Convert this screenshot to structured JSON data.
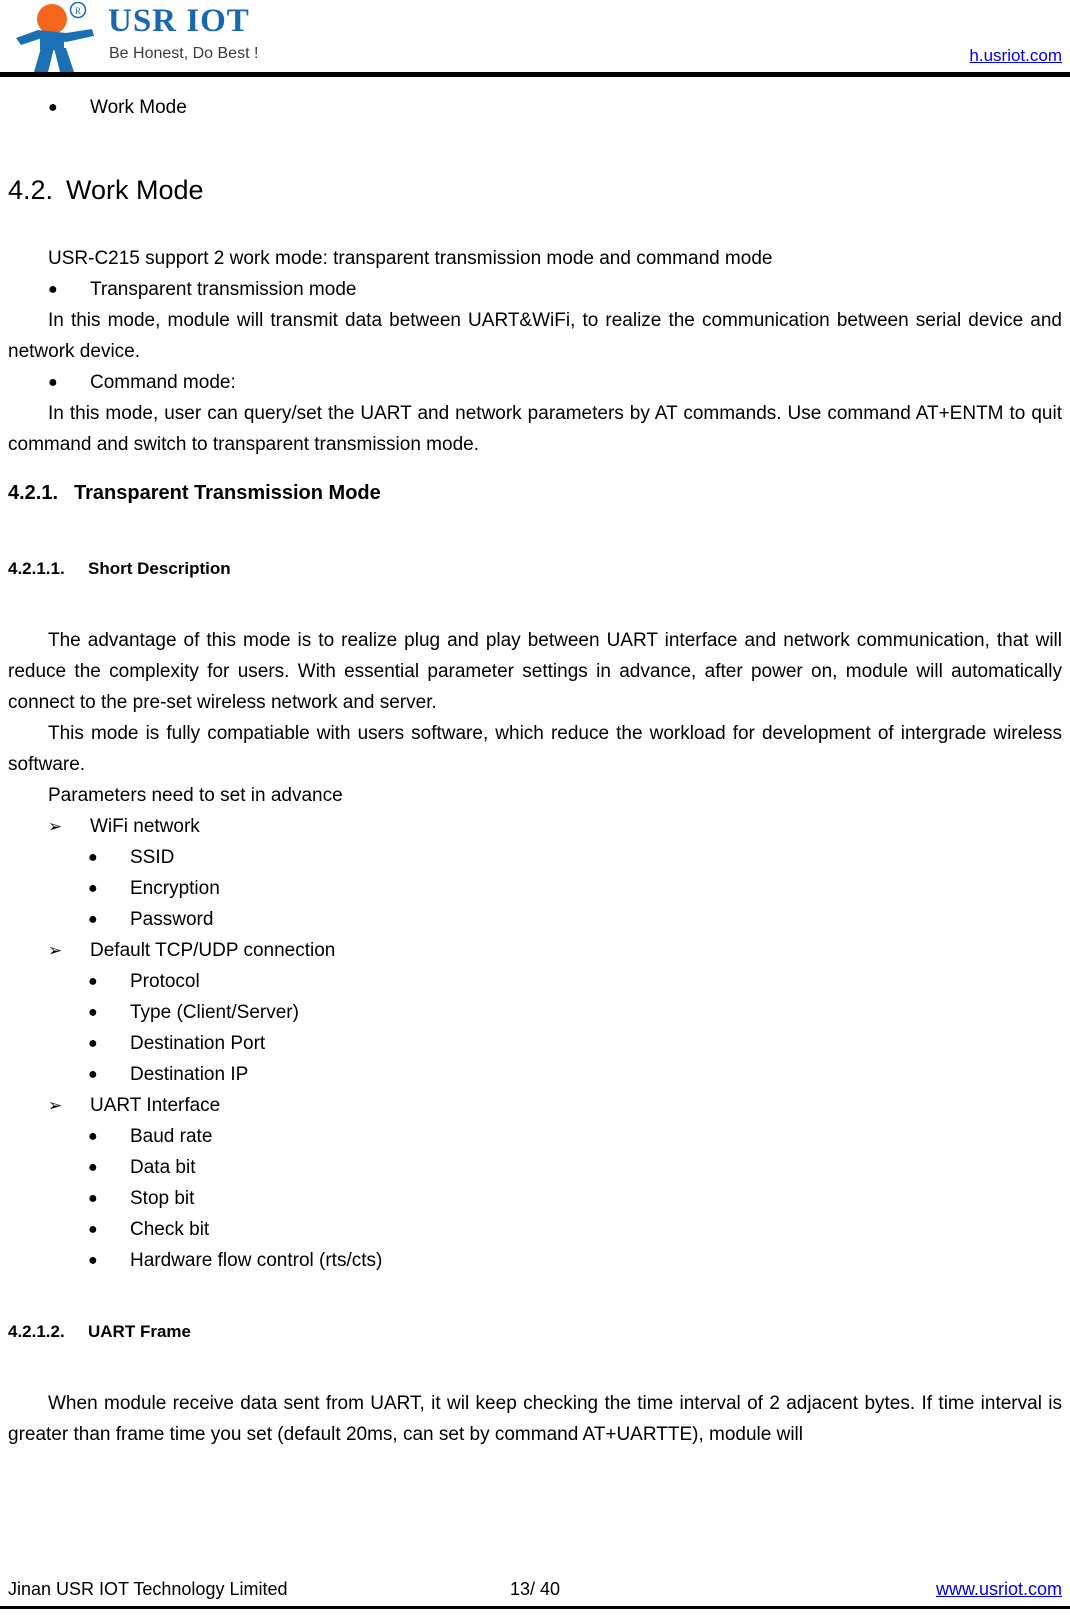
{
  "header": {
    "logo": {
      "wordmark": "USR IOT",
      "tagline": "Be Honest, Do Best !",
      "head_color": "#F4661B",
      "body_color": "#1B6FB5",
      "wordmark_color": "#1767B2"
    },
    "link": "h.usriot.com",
    "link_color": "#0000EE"
  },
  "body": {
    "top_bullet": "Work Mode",
    "section_heading": {
      "number": "4.2.",
      "title": "Work Mode"
    },
    "intro": "USR-C215 support 2 work mode: transparent transmission mode and command mode",
    "mode1_bullet": "Transparent transmission mode",
    "mode1_para": "In this mode, module will transmit data between UART&WiFi, to realize the communication between serial device and network device.",
    "mode2_bullet": "Command mode:",
    "mode2_para": "In this mode, user can query/set the UART and network parameters by AT commands. Use command AT+ENTM to quit command and switch to transparent transmission mode.",
    "sub_heading": {
      "number": "4.2.1.",
      "title": "Transparent Transmission Mode"
    },
    "subsub_heading_1": {
      "number": "4.2.1.1.",
      "title": "Short Description"
    },
    "desc_para_1": "The advantage of this mode is to realize plug and play between UART interface and network communication, that will reduce the complexity for users. With essential parameter settings in advance, after power on, module will automatically connect to the pre-set wireless network and server.",
    "desc_para_2": "This mode is fully compatiable with users software, which reduce the workload for development of intergrade wireless software.",
    "params_lead": "Parameters need to set in advance",
    "param_groups": [
      {
        "label": "WiFi network",
        "items": [
          "SSID",
          "Encryption",
          "Password"
        ]
      },
      {
        "label": "Default TCP/UDP connection",
        "items": [
          "Protocol",
          "Type (Client/Server)",
          "Destination Port",
          "Destination IP"
        ]
      },
      {
        "label": "UART Interface",
        "items": [
          "Baud rate",
          "Data bit",
          "Stop bit",
          "Check bit",
          "Hardware flow control (rts/cts)"
        ]
      }
    ],
    "subsub_heading_2": {
      "number": "4.2.1.2.",
      "title": "UART Frame"
    },
    "frame_para": "When module receive data sent from UART, it wil keep checking the time interval of 2 adjacent bytes. If time interval is greater than frame time you set (default 20ms, can set by command AT+UARTTE), module will",
    "markers": {
      "disc": "●",
      "arrow": "➢"
    }
  },
  "footer": {
    "company": "Jinan USR IOT Technology Limited",
    "page": "13/ 40",
    "link": "www.usriot.com"
  }
}
